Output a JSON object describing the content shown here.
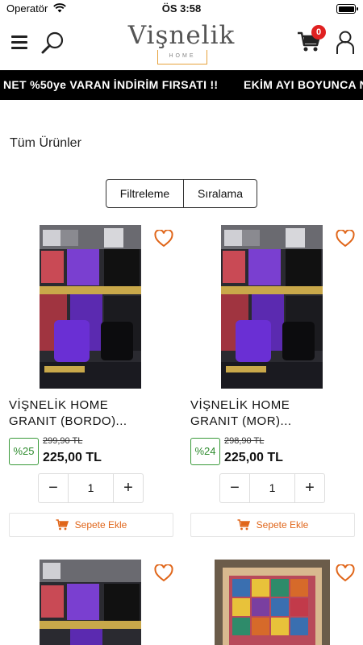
{
  "status": {
    "carrier": "Operatör",
    "time": "ÖS 3:58",
    "battery_level": 1.0
  },
  "header": {
    "logo_text": "Vişnelik",
    "logo_sub": "HOME",
    "cart_count": "0",
    "icons": [
      "menu-icon",
      "search-icon",
      "cart-icon",
      "user-icon"
    ]
  },
  "marquee": {
    "text1": "NET %50ye VARAN İNDİRİM FIRSATI !!",
    "text2": "EKİM AYI BOYUNCA N"
  },
  "page": {
    "title": "Tüm Ürünler",
    "filter_label": "Filtreleme",
    "sort_label": "Sıralama"
  },
  "products": [
    {
      "name": "VİŞNELİK HOME GRANIT (BORDO)...",
      "name_line1": "VİŞNELİK HOME",
      "name_line2": "GRANIT (BORDO)...",
      "discount": "%25",
      "old_price": "299,90 TL",
      "price": "225,00 TL",
      "quantity": "1",
      "add_to_cart": "Sepete Ekle"
    },
    {
      "name": "VİŞNELİK HOME GRANIT (MOR)...",
      "name_line1": "VİŞNELİK HOME",
      "name_line2": "GRANIT (MOR)...",
      "discount": "%24",
      "old_price": "298,90 TL",
      "price": "225,00 TL",
      "quantity": "1",
      "add_to_cart": "Sepete Ekle"
    }
  ],
  "colors": {
    "accent": "#e0661a",
    "badge": "#e02020",
    "discount": "#2e8b2e"
  }
}
